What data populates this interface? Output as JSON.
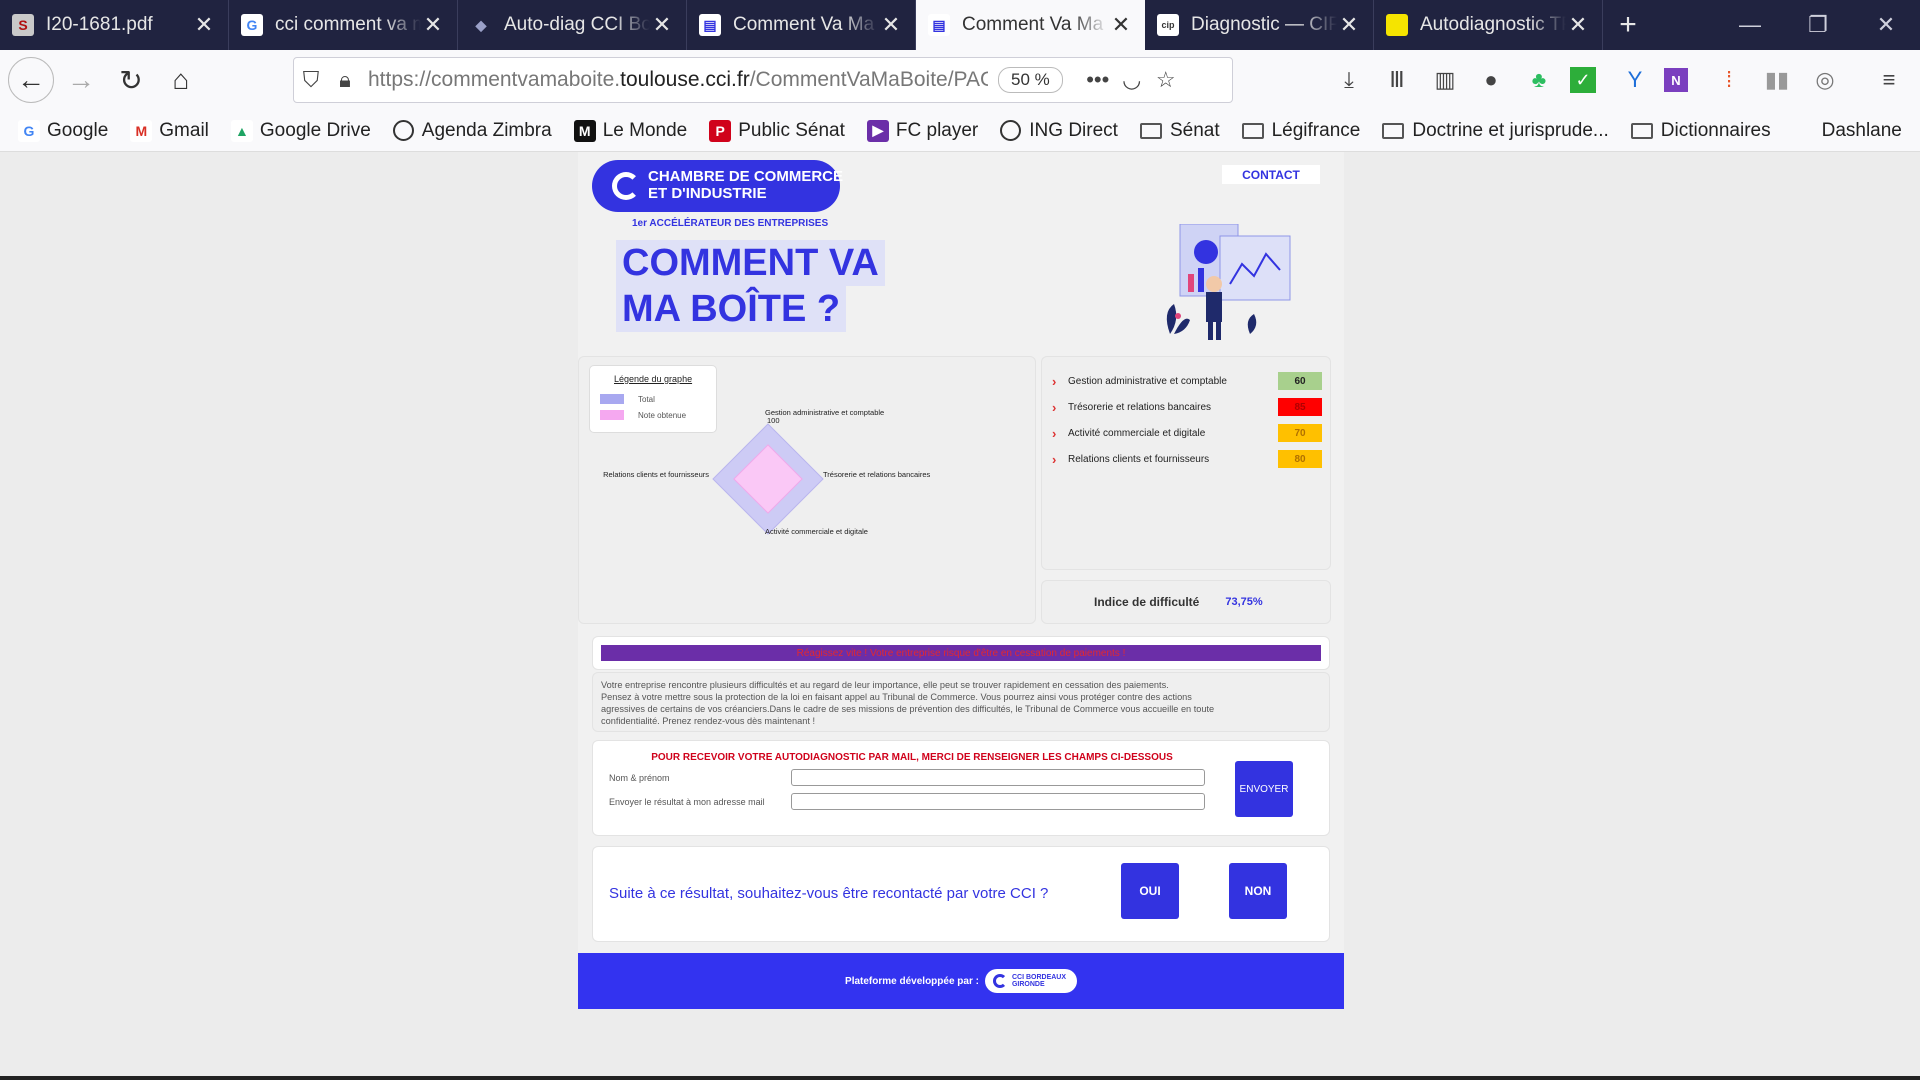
{
  "browser": {
    "tabs": [
      {
        "title": "I20-1681.pdf",
        "fav": "S",
        "fav_bg": "#c9c9c9",
        "fav_fg": "#b01010"
      },
      {
        "title": "cci comment va ma boîte",
        "fav": "G",
        "fav_bg": "#ffffff",
        "fav_fg": "#4285f4"
      },
      {
        "title": "Auto-diag CCI Bordeaux",
        "fav": "◆",
        "fav_bg": "#202340",
        "fav_fg": "#9aa0c8"
      },
      {
        "title": "Comment Va Ma Boîte",
        "fav": "▤",
        "fav_bg": "#ffffff",
        "fav_fg": "#3333e0"
      },
      {
        "title": "Comment Va Ma Boîte",
        "fav": "▤",
        "fav_bg": "#ffffff",
        "fav_fg": "#3333e0"
      },
      {
        "title": "Diagnostic — CIP",
        "fav": "cip",
        "fav_bg": "#ffffff",
        "fav_fg": "#333333"
      },
      {
        "title": "Autodiagnostic TPE",
        "fav": "",
        "fav_bg": "#f5e400",
        "fav_fg": "#f5e400"
      }
    ],
    "active_tab": 4,
    "url_prefix": "https://commentvamaboite.",
    "url_domain": "toulouse.cci.fr",
    "url_path": "/CommentVaMaBoite/PAGE",
    "zoom": "50 %",
    "bookmarks": [
      {
        "label": "Google",
        "icon": "google-icon"
      },
      {
        "label": "Gmail",
        "icon": "gmail-icon"
      },
      {
        "label": "Google Drive",
        "icon": "drive-icon"
      },
      {
        "label": "Agenda Zimbra",
        "icon": "globe-icon"
      },
      {
        "label": "Le Monde",
        "icon": "lemonde-icon"
      },
      {
        "label": "Public Sénat",
        "icon": "publicsenat-icon"
      },
      {
        "label": "FC player",
        "icon": "fcplayer-icon"
      },
      {
        "label": "ING Direct",
        "icon": "globe-icon"
      },
      {
        "label": "Sénat",
        "icon": "folder-icon"
      },
      {
        "label": "Légifrance",
        "icon": "folder-icon"
      },
      {
        "label": "Doctrine et jurisprude...",
        "icon": "folder-icon"
      },
      {
        "label": "Dictionnaires",
        "icon": "folder-icon"
      },
      {
        "label": "Dashlane",
        "icon": "dashlane-icon"
      }
    ]
  },
  "page": {
    "logo_line1": "CHAMBRE DE COMMERCE",
    "logo_line2": "ET D'INDUSTRIE",
    "logo_tagline": "1er ACCÉLÉRATEUR DES ENTREPRISES",
    "contact": "CONTACT",
    "headline_line1": "COMMENT VA",
    "headline_line2": "MA BOÎTE ?",
    "legend": {
      "title": "Légende du graphe",
      "items": [
        {
          "label": "Total",
          "color": "#a8a8f0"
        },
        {
          "label": "Note obtenue",
          "color": "#f5a8f0"
        }
      ]
    },
    "radar": {
      "axes": [
        "Gestion administrative et comptable",
        "Trésorerie et relations bancaires",
        "Activité commerciale et digitale",
        "Relations clients et fournisseurs"
      ],
      "max_label": "100",
      "max": 100
    },
    "scores": [
      {
        "label": "Gestion administrative et comptable",
        "value": "60",
        "bg": "#a8d08d",
        "fg": "#222222"
      },
      {
        "label": "Trésorerie et relations bancaires",
        "value": "85",
        "bg": "#ff0000",
        "fg": "#b00000"
      },
      {
        "label": "Activité commerciale et digitale",
        "value": "70",
        "bg": "#ffc000",
        "fg": "#b07000"
      },
      {
        "label": "Relations clients et fournisseurs",
        "value": "80",
        "bg": "#ffc000",
        "fg": "#b07000"
      }
    ],
    "difficulty_label": "Indice de difficulté",
    "difficulty_value": "73,75%",
    "alert": "Réagissez vite ! Votre entreprise risque d'être en cessation de paiements !",
    "message_lines": [
      "Votre entreprise rencontre plusieurs difficultés et au regard de leur importance, elle peut se trouver rapidement en cessation des paiements.",
      "Pensez à votre mettre sous la protection de la loi en faisant appel au Tribunal de Commerce. Vous pourrez ainsi vous protéger contre des actions",
      "agressives de certains de vos créanciers.Dans le cadre de ses missions de prévention des difficultés, le Tribunal de Commerce vous accueille en toute",
      "confidentialité. Prenez rendez-vous dès maintenant !"
    ],
    "form_title": "POUR RECEVOIR VOTRE AUTODIAGNOSTIC PAR MAIL, MERCI DE RENSEIGNER LES CHAMPS CI-DESSOUS",
    "field_name_label": "Nom & prénom",
    "field_email_label": "Envoyer le résultat à mon adresse mail",
    "field_name_value": "",
    "field_email_value": "",
    "send_label": "ENVOYER",
    "recontact_question": "Suite à ce résultat, souhaitez-vous être recontacté par votre CCI ?",
    "yes_label": "OUI",
    "no_label": "NON",
    "footer_text": "Plateforme développée par :",
    "footer_logo_line1": "CCI BORDEAUX",
    "footer_logo_line2": "GIRONDE"
  }
}
